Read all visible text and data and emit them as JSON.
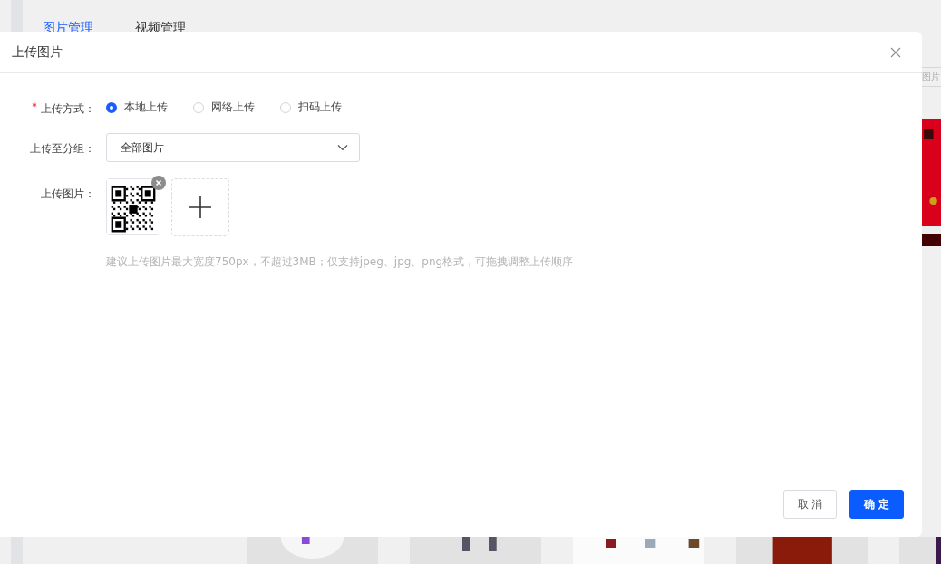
{
  "background": {
    "tabs": [
      {
        "label": "图片管理",
        "selected": true
      },
      {
        "label": "视频管理",
        "selected": false
      }
    ],
    "search_fragment": "图片"
  },
  "dialog": {
    "title": "上传图片",
    "fields": [
      {
        "kind": "radio",
        "label": "上传方式：",
        "required": true,
        "options": [
          {
            "label": "本地上传",
            "selected": true
          },
          {
            "label": "网络上传",
            "selected": false
          },
          {
            "label": "扫码上传",
            "selected": false
          }
        ]
      },
      {
        "kind": "select",
        "label": "上传至分组：",
        "required": false,
        "value": "全部图片"
      },
      {
        "kind": "upload",
        "label": "上传图片：",
        "required": false,
        "hint": "建议上传图片最大宽度750px，不超过3MB；仅支持jpeg、jpg、png格式，可拖拽调整上传顺序"
      }
    ],
    "buttons": [
      {
        "label": "取 消",
        "primary": false
      },
      {
        "label": "确 定",
        "primary": true
      }
    ]
  }
}
